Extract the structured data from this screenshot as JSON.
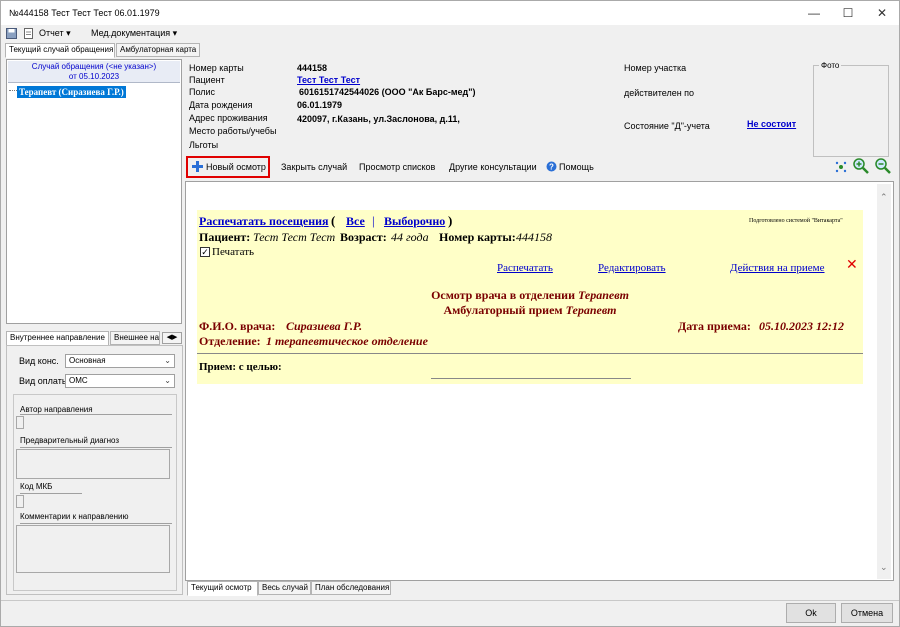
{
  "window": {
    "title": "№444158 Тест Тест Тест 06.01.1979"
  },
  "menu": {
    "report": "Отчет ▾",
    "med_docs": "Мед.документация ▾"
  },
  "main_tabs": [
    "Текущий случай обращения",
    "Амбулаторная карта"
  ],
  "case_tree": {
    "header_line1": "Случай обращения (<не указан>)",
    "header_line2": "от 05.10.2023",
    "item": "Терапевт (Сиразиева Г.Р.)"
  },
  "referral_tabs": [
    "Внутреннее направление",
    "Внешнее на"
  ],
  "referral": {
    "kons_label": "Вид конс.",
    "kons_value": "Основная",
    "pay_label": "Вид оплаты",
    "pay_value": "ОМС",
    "author_label": "Автор направления",
    "diag_label": "Предварительный диагноз",
    "mkb_label": "Код МКБ",
    "comment_label": "Комментарии к направлению"
  },
  "patient": {
    "card_label": "Номер карты",
    "card_value": "444158",
    "patient_label": "Пациент",
    "patient_value": "Тест Тест Тест",
    "policy_label": "Полис",
    "policy_value": "6016151742544026 (ООО \"Ак Барс-мед\")",
    "dob_label": "Дата рождения",
    "dob_value": "06.01.1979",
    "address_label": "Адрес проживания",
    "address_value": "420097, г.Казань, ул.Заслонова, д.11,",
    "work_label": "Место работы/учебы",
    "benefits_label": "Льготы",
    "district_label": "Номер участка",
    "valid_label": "действителен по",
    "d_state_label": "Состояние \"Д\"-учета",
    "d_state_value": "Не состоит",
    "photo_label": "Фото"
  },
  "toolbar": {
    "new_exam": "Новый осмотр",
    "close_case": "Закрыть случай",
    "view_lists": "Просмотр списков",
    "other_consult": "Другие консультации",
    "help": "Помощь"
  },
  "doc": {
    "print_visits": "Распечатать посещения",
    "open_paren": "(",
    "all": "Все",
    "sep": "|",
    "selective": "Выборочно",
    "close_paren": ")",
    "prepared_by": "Подготовлено системой \"Витакарта\"",
    "patient_label": "Пациент:",
    "patient_name": "Тест Тест Тест",
    "age_label": "Возраст:",
    "age_value": "44 года",
    "card_label": "Номер карты:",
    "card_value": "444158",
    "print_check": "Печатать",
    "print_link": "Распечатать",
    "edit_link": "Редактировать",
    "actions_link": "Действия на приеме",
    "title1_prefix": "Осмотр врача в отделении",
    "title1_spec": "Терапевт",
    "title2_prefix": "Амбулаторный прием",
    "title2_spec": "Терапевт",
    "doctor_label": "Ф.И.О. врача:",
    "doctor_name": "Сиразиева Г.Р.",
    "date_label": "Дата приема:",
    "date_value": "05.10.2023 12:12",
    "dept_label": "Отделение:",
    "dept_value": "1 терапевтическое отделение",
    "purpose_label": "Прием: с целью:"
  },
  "bottom_tabs": [
    "Текущий осмотр",
    "Весь случай",
    "План обследования"
  ],
  "buttons": {
    "ok": "Ok",
    "cancel": "Отмена"
  },
  "colors": {
    "highlight": "#0078d7",
    "doc_bg": "#ffffc8",
    "doc_text": "#7a0000",
    "link": "#0000cc",
    "red_box": "#e00000"
  }
}
